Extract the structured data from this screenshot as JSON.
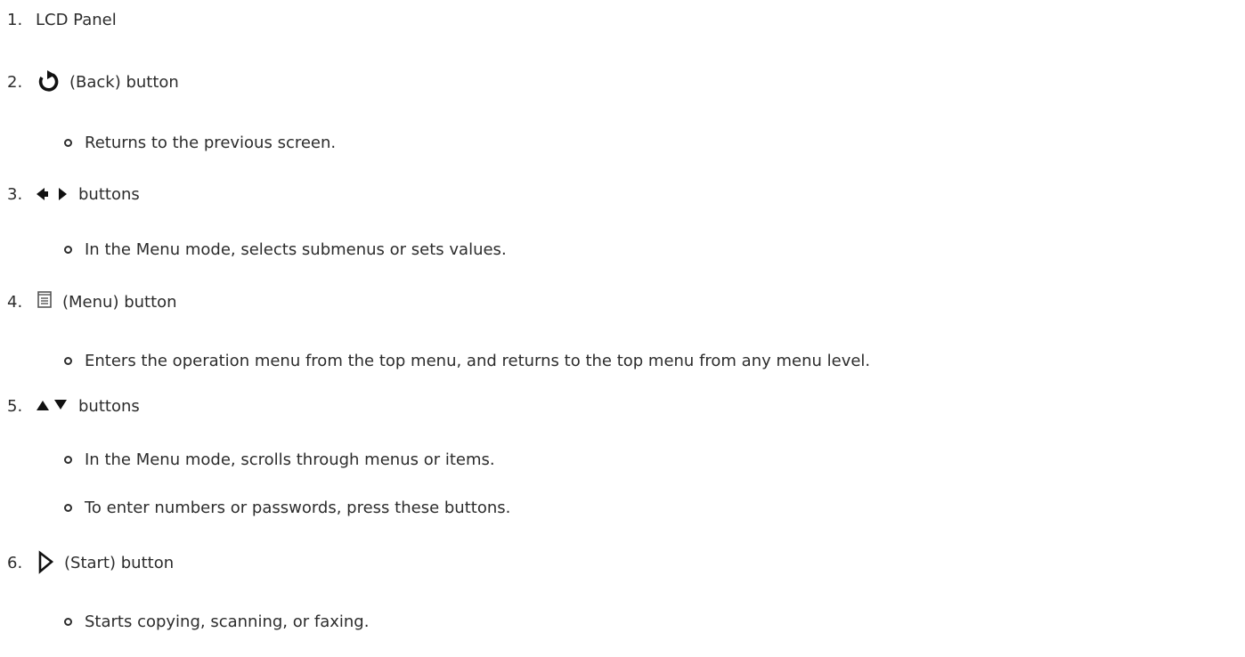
{
  "items": [
    {
      "number": "1.",
      "icon": "",
      "label": "LCD Panel",
      "bullets": []
    },
    {
      "number": "2.",
      "icon": "back-icon",
      "label": "(Back) button",
      "bullets": [
        "Returns to the previous screen."
      ]
    },
    {
      "number": "3.",
      "icon": "left-right-arrows-icon",
      "label": "buttons",
      "bullets": [
        "In the Menu mode, selects submenus or sets values."
      ]
    },
    {
      "number": "4.",
      "icon": "menu-icon",
      "label": "(Menu) button",
      "bullets": [
        "Enters the operation menu from the top menu, and returns to the top menu from any menu level."
      ]
    },
    {
      "number": "5.",
      "icon": "up-down-arrows-icon",
      "label": "buttons",
      "bullets": [
        "In the Menu mode, scrolls through menus or items.",
        "To enter numbers or passwords, press these buttons."
      ]
    },
    {
      "number": "6.",
      "icon": "start-icon",
      "label": "(Start) button",
      "bullets": [
        "Starts copying, scanning, or faxing."
      ]
    }
  ],
  "colors": {
    "text": "#2c2c2c",
    "background": "#ffffff"
  }
}
